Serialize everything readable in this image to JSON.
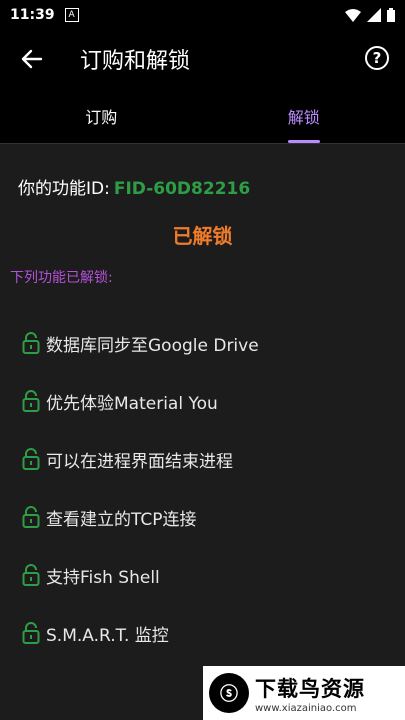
{
  "status": {
    "time": "11:39",
    "notif_icon": "A"
  },
  "app_bar": {
    "title": "订购和解锁"
  },
  "tabs": [
    {
      "label": "订购"
    },
    {
      "label": "解锁"
    }
  ],
  "content": {
    "fid_label": "你的功能ID:",
    "fid_value": "FID-60D82216",
    "unlocked_title": "已解锁",
    "list_header": "下列功能已解锁:",
    "features": [
      {
        "label": "数据库同步至Google Drive"
      },
      {
        "label": "优先体验Material You"
      },
      {
        "label": "可以在进程界面结束进程"
      },
      {
        "label": "查看建立的TCP连接"
      },
      {
        "label": "支持Fish Shell"
      },
      {
        "label": "S.M.A.R.T. 监控"
      }
    ]
  },
  "watermark": {
    "title": "下载鸟资源",
    "url": "www.xiazainiao.com"
  },
  "colors": {
    "accent": "#b88cff",
    "fid": "#2e9e46",
    "unlocked": "#f07c2b",
    "list_header": "#b451d8"
  }
}
